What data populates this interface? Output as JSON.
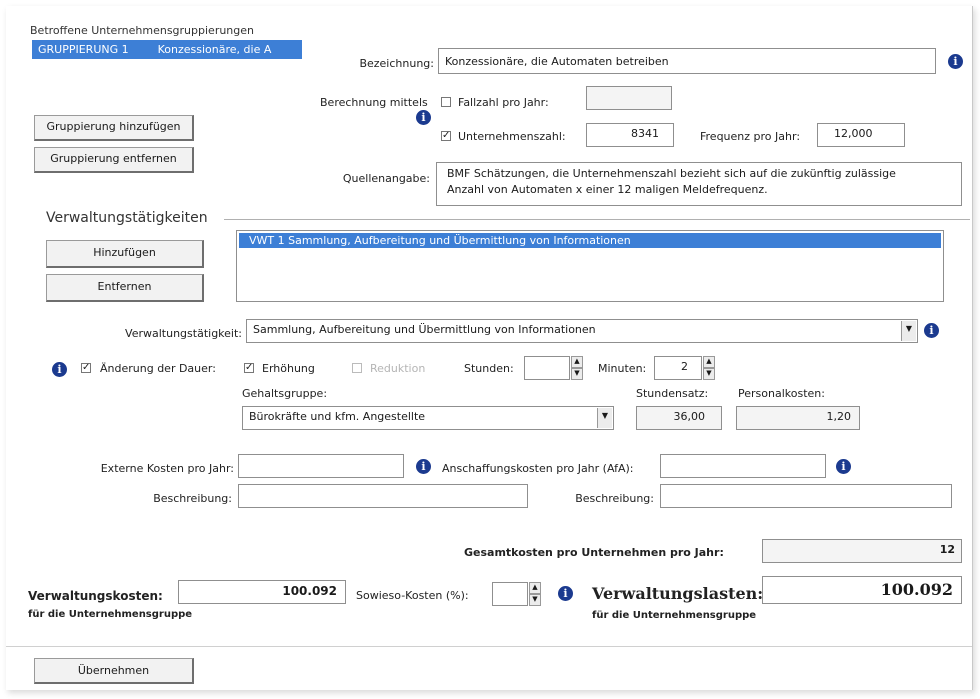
{
  "grouping": {
    "header_label": "Betroffene Unternehmensgruppierungen",
    "selected_item": {
      "code": "GRUPPIERUNG 1",
      "name": "Konzessionäre, die A"
    },
    "add_button": "Gruppierung hinzufügen",
    "remove_button": "Gruppierung entfernen"
  },
  "details": {
    "designation_label": "Bezeichnung:",
    "designation_value": "Konzessionäre, die Automaten betreiben",
    "calc_label": "Berechnung mittels",
    "case_count_label": "Fallzahl pro Jahr:",
    "case_count_value": "",
    "company_count_label": "Unternehmenszahl:",
    "company_count_value": "8341",
    "frequency_label": "Frequenz pro Jahr:",
    "frequency_value": "12,000",
    "source_label": "Quellenangabe:",
    "source_line1": "BMF Schätzungen, die Unternehmenszahl bezieht sich auf die zukünftig zulässige",
    "source_line2": "Anzahl von Automaten x einer 12 maligen Meldefrequenz."
  },
  "admin": {
    "section_title": "Verwaltungstätigkeiten",
    "add_button": "Hinzufügen",
    "remove_button": "Entfernen",
    "list_item": "VWT 1   Sammlung, Aufbereitung und Übermittlung von Informationen",
    "activity_label": "Verwaltungstätigkeit:",
    "activity_value": "Sammlung, Aufbereitung und Übermittlung von Informationen",
    "duration_change_label": "Änderung der Dauer:",
    "increase_label": "Erhöhung",
    "reduction_label": "Reduktion",
    "hours_label": "Stunden:",
    "hours_value": "",
    "minutes_label": "Minuten:",
    "minutes_value": "2",
    "salary_group_label": "Gehaltsgruppe:",
    "salary_group_value": "Bürokräfte und kfm. Angestellte",
    "hourly_rate_label": "Stundensatz:",
    "hourly_rate_value": "36,00",
    "personnel_cost_label": "Personalkosten:",
    "personnel_cost_value": "1,20",
    "external_cost_label": "Externe Kosten pro Jahr:",
    "external_cost_value": "",
    "acquisition_cost_label": "Anschaffungskosten pro Jahr (AfA):",
    "acquisition_cost_value": "",
    "description_label": "Beschreibung:",
    "description1_value": "",
    "description2_value": ""
  },
  "totals": {
    "total_per_company_label": "Gesamtkosten pro Unternehmen pro Jahr:",
    "total_per_company_value": "12",
    "admin_cost_label": "Verwaltungskosten:",
    "admin_cost_value": "100.092",
    "group_sub_label": "für die Unternehmensgruppe",
    "sowieso_label": "Sowieso-Kosten (%):",
    "sowieso_value": "",
    "admin_burden_label": "Verwaltungslasten:",
    "admin_burden_value": "100.092",
    "group_sub_label2": "für die Unternehmensgruppe"
  },
  "footer": {
    "apply_button": "Übernehmen"
  },
  "colors": {
    "selection": "#3d7fd6",
    "info_icon": "#1b3a8f"
  }
}
